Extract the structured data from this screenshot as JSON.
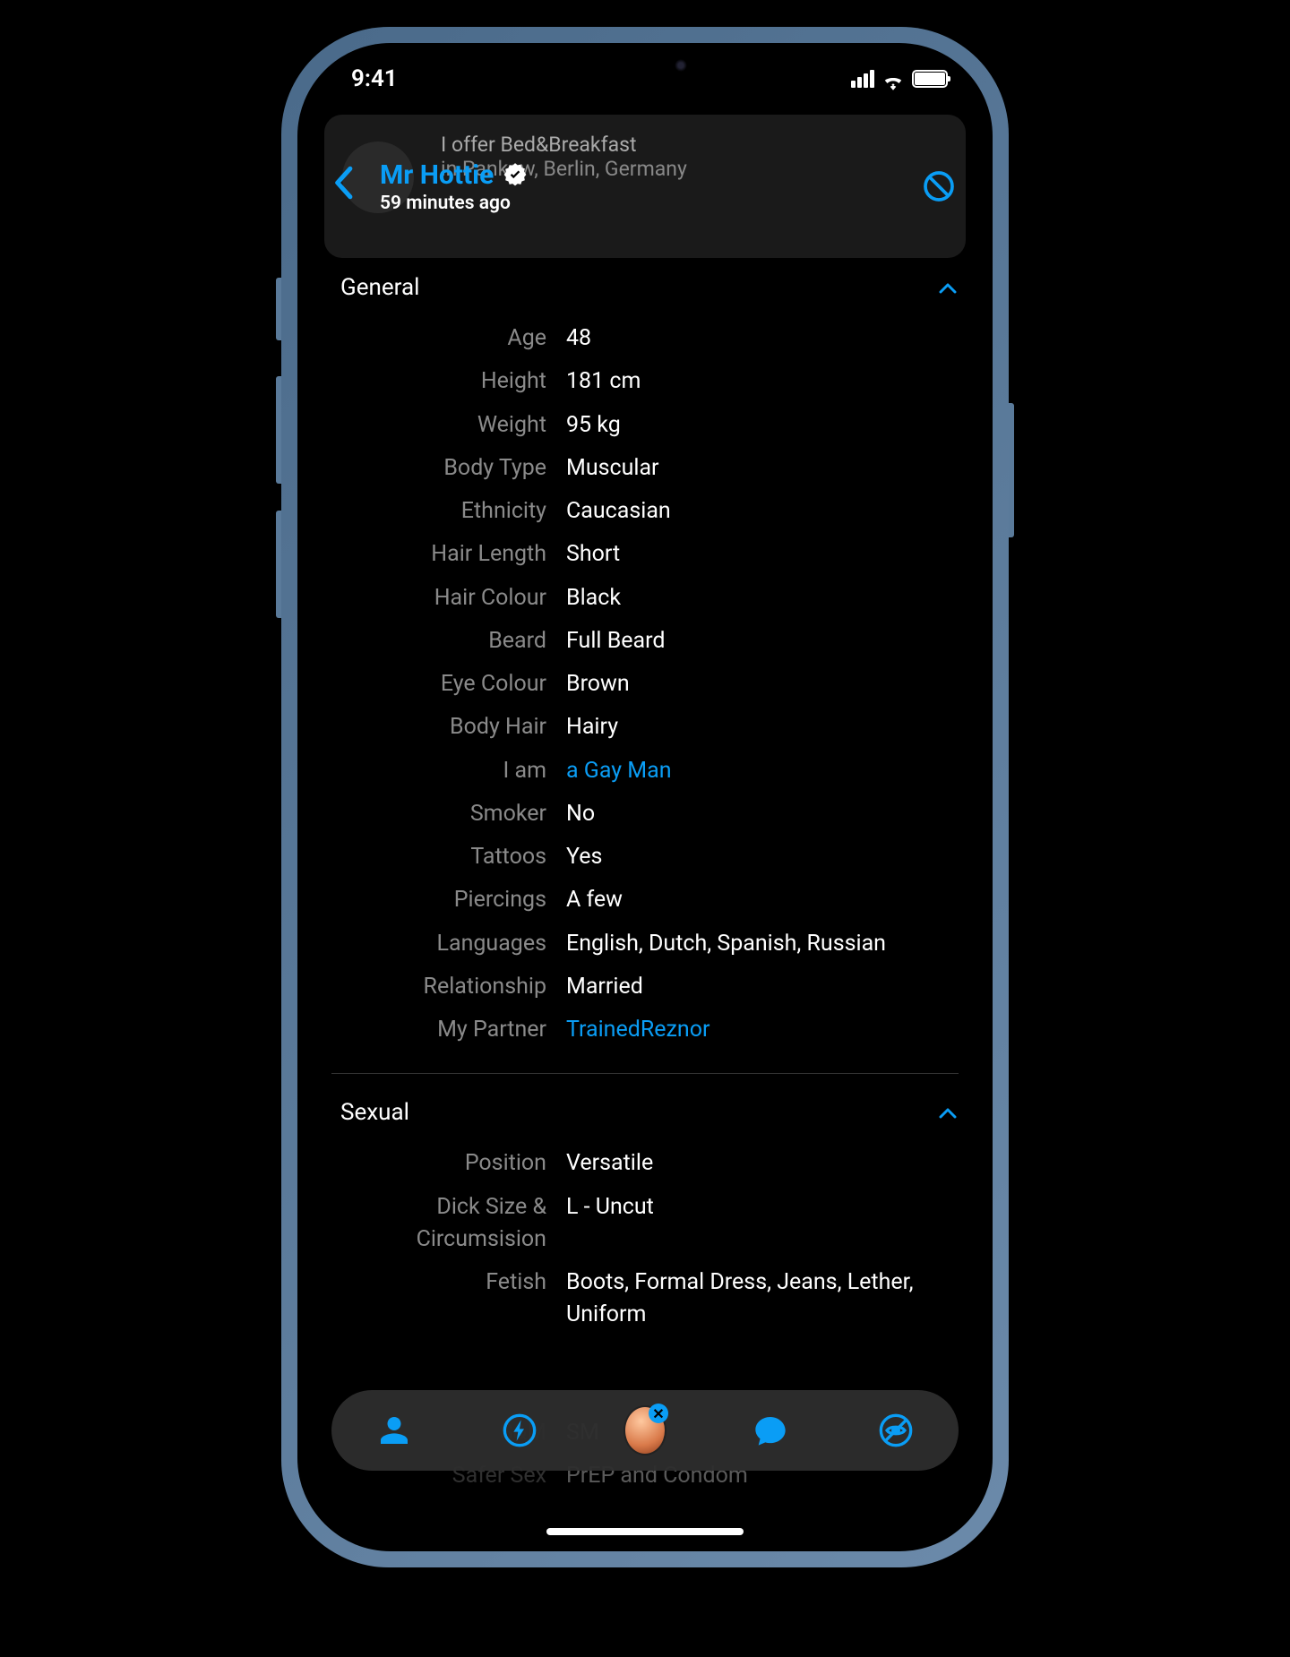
{
  "status": {
    "time": "9:41"
  },
  "bg_card": {
    "line1": "I offer Bed&Breakfast",
    "line2_prefix": "in ",
    "line2_city": "Pankow, Berlin, Germany"
  },
  "header": {
    "name": "Mr Hottie",
    "timestamp": "59 minutes ago"
  },
  "sections": {
    "general": {
      "title": "General",
      "rows": [
        {
          "label": "Age",
          "value": "48"
        },
        {
          "label": "Height",
          "value": "181 cm"
        },
        {
          "label": "Weight",
          "value": "95 kg"
        },
        {
          "label": "Body Type",
          "value": "Muscular"
        },
        {
          "label": "Ethnicity",
          "value": "Caucasian"
        },
        {
          "label": "Hair Length",
          "value": "Short"
        },
        {
          "label": "Hair Colour",
          "value": "Black"
        },
        {
          "label": "Beard",
          "value": "Full Beard"
        },
        {
          "label": "Eye Colour",
          "value": "Brown"
        },
        {
          "label": "Body Hair",
          "value": "Hairy"
        },
        {
          "label": "I am",
          "value": "a Gay Man",
          "link": true
        },
        {
          "label": "Smoker",
          "value": "No"
        },
        {
          "label": "Tattoos",
          "value": "Yes"
        },
        {
          "label": "Piercings",
          "value": "A few"
        },
        {
          "label": "Languages",
          "value": "English, Dutch, Spanish, Russian"
        },
        {
          "label": "Relationship",
          "value": "Married"
        },
        {
          "label": "My Partner",
          "value": "TrainedReznor",
          "link": true
        }
      ]
    },
    "sexual": {
      "title": "Sexual",
      "rows": [
        {
          "label": "Position",
          "value": "Versatile"
        },
        {
          "label": "Dick Size & Circumsision",
          "value": "L - Uncut"
        },
        {
          "label": "Fetish",
          "value": "Boots, Formal Dress, Jeans, Lether, Uniform"
        }
      ]
    },
    "faded": {
      "rows": [
        {
          "label": "S&M",
          "value": "SM"
        },
        {
          "label": "Safer Sex",
          "value": "PrEP and Condom"
        }
      ]
    }
  },
  "nav": {
    "center_x": "✕"
  }
}
